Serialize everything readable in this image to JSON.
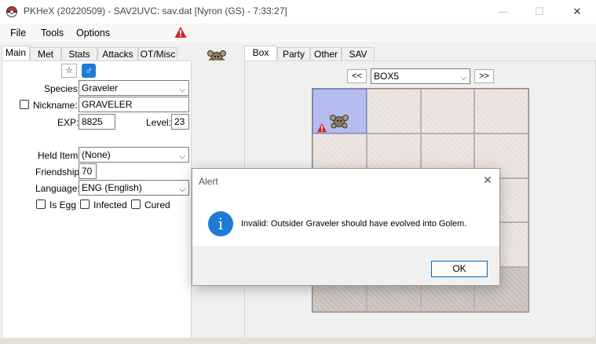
{
  "window": {
    "title": "PKHeX (20220509) - SAV2UVC: sav.dat [Nyron (GS) - 7:33:27]",
    "minimize": "—",
    "maximize": "☐",
    "close": "✕"
  },
  "menu": {
    "file": "File",
    "tools": "Tools",
    "options": "Options"
  },
  "left_tabs": [
    "Main",
    "Met",
    "Stats",
    "Attacks",
    "OT/Misc"
  ],
  "right_tabs": [
    "Box",
    "Party",
    "Other",
    "SAV"
  ],
  "main": {
    "shiny_star": "☆",
    "gender_symbol": "♂",
    "species_label": "Species:",
    "species_value": "Graveler",
    "nickname_label": "Nickname:",
    "nickname_value": "GRAVELER",
    "exp_label": "EXP:",
    "exp_value": "8825",
    "level_label": "Level:",
    "level_value": "23",
    "held_item_label": "Held Item:",
    "held_item_value": "(None)",
    "friendship_label": "Friendship:",
    "friendship_value": "70",
    "language_label": "Language:",
    "language_value": "ENG (English)",
    "is_egg_label": "Is Egg",
    "infected_label": "Infected",
    "cured_label": "Cured"
  },
  "box": {
    "prev": "<<",
    "next": ">>",
    "selected_box": "BOX5",
    "slots": 20
  },
  "dialog": {
    "title": "Alert",
    "info_glyph": "i",
    "message": "Invalid: Outsider Graveler should have evolved into Golem.",
    "ok": "OK",
    "close": "✕"
  },
  "colors": {
    "accent_blue": "#1e7bd6",
    "warning_red": "#d4242a",
    "selected_slot": "#b5bdf0"
  }
}
